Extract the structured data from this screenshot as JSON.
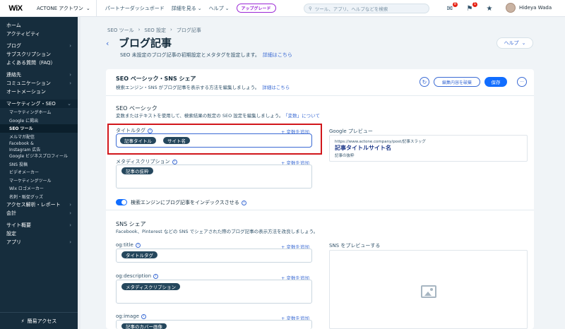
{
  "topbar": {
    "logo": "WiX",
    "site_name": "ACTONE アクトワン",
    "nav": [
      "パートナーダッシュボード",
      "詳細を見る",
      "ヘルプ"
    ],
    "upgrade": "アップグレード",
    "search_placeholder": "ツール、アプリ、ヘルプなどを検索",
    "notifications": {
      "messages": "8",
      "bell": "1"
    },
    "user_name": "Hideya Wada"
  },
  "sidebar": {
    "top": [
      "ホーム",
      "アクティビティ"
    ],
    "group1": [
      {
        "label": "ブログ",
        "chevron": true
      },
      {
        "label": "サブスクリプション",
        "chevron": false
      },
      {
        "label": "よくある質問（FAQ）",
        "chevron": false
      }
    ],
    "group2": [
      {
        "label": "連絡先",
        "chevron": true
      },
      {
        "label": "コミュニケーション",
        "chevron": true
      },
      {
        "label": "オートメーション",
        "chevron": false
      }
    ],
    "marketing": {
      "label": "マーケティング・SEO",
      "items": [
        "マーケティングホーム",
        "Google に掲出",
        "SEO ツール",
        "メルマガ配信"
      ],
      "facebook": [
        "Facebook &",
        "Instagram 広告"
      ],
      "items2": [
        "Google ビジネスプロフィール",
        "SNS 投稿",
        "ビデオメーカー",
        "マーケティングツール",
        "Wix ロゴメーカー",
        "名刺・販促グッズ"
      ],
      "active": "SEO ツール"
    },
    "group3": [
      {
        "label": "アクセス解析・レポート",
        "chevron": true
      },
      {
        "label": "会計",
        "chevron": true
      }
    ],
    "group4": [
      {
        "label": "サイト概要",
        "chevron": true
      },
      {
        "label": "設定",
        "chevron": false
      },
      {
        "label": "アプリ",
        "chevron": true
      }
    ],
    "footer": "簡易アクセス"
  },
  "page": {
    "breadcrumb": [
      "SEO ツール",
      "SEO 設定",
      "ブログ記事"
    ],
    "title": "ブログ記事",
    "subtitle": "SEO 未設定のブログ記事の初期設定とメタタグを設定します。",
    "subtitle_link": "詳細はこちら",
    "help": "ヘルプ"
  },
  "card": {
    "title": "SEO ベーシック・SNS シェア",
    "subtitle": "検索エンジン・SNS がブログ記事を表示する方法を編集しましょう。",
    "subtitle_link": "詳細はこちら",
    "discard": "編集内容を破棄",
    "save": "保存"
  },
  "seo_basic": {
    "title": "SEO ベーシック",
    "subtitle": "変数またはテキストを使用して、検索結果の既定の SEO 設定を編集しましょう。",
    "subtitle_link": "「変数」について",
    "title_tag_label": "タイトルタグ",
    "title_tag_chips": [
      "記事タイトル",
      "サイト名"
    ],
    "meta_label": "メタディスクリプション",
    "meta_chips": [
      "記事の抜粋"
    ],
    "add_variable": "変数を追加",
    "google_preview_label": "Google プレビュー",
    "google_preview": {
      "url": "https://www.actone.company/post/記事スラッグ",
      "title": "記事タイトルサイト名",
      "description": "記事の抜粋"
    },
    "index_toggle": "検索エンジンにブログ記事をインデックスさせる"
  },
  "sns": {
    "title": "SNS シェア",
    "subtitle": "Facebook、Pinterest などの SNS でシェアされた際のブログ記事の表示方法を改良しましょう。",
    "og_title_label": "og:title",
    "og_title_chip": "タイトルタグ",
    "og_desc_label": "og:description",
    "og_desc_chip": "メタディスクリプション",
    "og_image_label": "og:image",
    "og_image_chip": "記事のカバー画像",
    "preview_label": "SNS をプレビューする"
  }
}
